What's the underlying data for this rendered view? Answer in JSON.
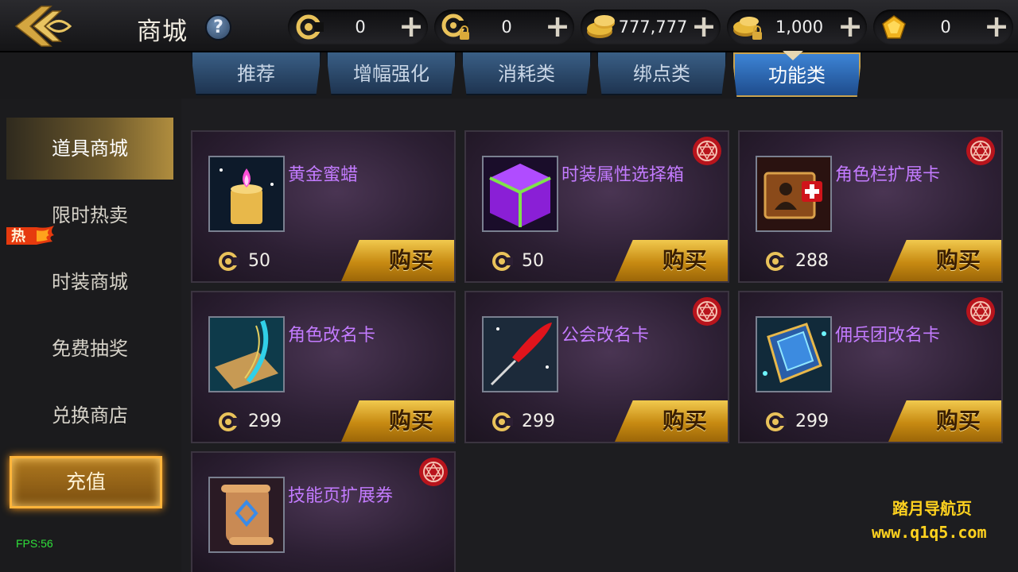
{
  "header": {
    "title": "商城",
    "help_glyph": "?",
    "currencies": [
      {
        "icon": "coin-c-icon",
        "value": "0"
      },
      {
        "icon": "coin-c-locked-icon",
        "value": "0"
      },
      {
        "icon": "gold-coins-icon",
        "value": "777,777"
      },
      {
        "icon": "gold-coins-locked-icon",
        "value": "1,000"
      },
      {
        "icon": "gem-icon",
        "value": "0"
      }
    ],
    "plus_glyph": "+"
  },
  "tabs": [
    {
      "label": "推荐",
      "active": false
    },
    {
      "label": "增幅强化",
      "active": false
    },
    {
      "label": "消耗类",
      "active": false
    },
    {
      "label": "绑点类",
      "active": false
    },
    {
      "label": "功能类",
      "active": true
    }
  ],
  "sidebar": {
    "items": [
      {
        "label": "道具商城",
        "active": true
      },
      {
        "label": "限时热卖",
        "active": false,
        "badge": "热"
      },
      {
        "label": "时装商城",
        "active": false
      },
      {
        "label": "免费抽奖",
        "active": false
      },
      {
        "label": "兑换商店",
        "active": false
      }
    ],
    "recharge_label": "充值",
    "fps": "FPS:56"
  },
  "products": [
    {
      "name": "黄金蜜蜡",
      "price": "50",
      "icon": "golden-candle-icon",
      "seal": false,
      "buy": "购买"
    },
    {
      "name": "时装属性选择箱",
      "price": "50",
      "icon": "purple-box-icon",
      "seal": true,
      "buy": "购买"
    },
    {
      "name": "角色栏扩展卡",
      "price": "288",
      "icon": "character-slot-card-icon",
      "seal": true,
      "buy": "购买"
    },
    {
      "name": "角色改名卡",
      "price": "299",
      "icon": "rename-scroll-icon",
      "seal": false,
      "buy": "购买"
    },
    {
      "name": "公会改名卡",
      "price": "299",
      "icon": "red-quill-icon",
      "seal": true,
      "buy": "购买"
    },
    {
      "name": "佣兵团改名卡",
      "price": "299",
      "icon": "guild-rename-book-icon",
      "seal": true,
      "buy": "购买"
    },
    {
      "name": "技能页扩展券",
      "price": "",
      "icon": "skill-scroll-icon",
      "seal": true,
      "buy": ""
    }
  ],
  "watermark": {
    "line1": "踏月导航页",
    "line2": "www.q1q5.com"
  },
  "colors": {
    "item_name": "#c37bff",
    "buy_button": "#e0a82a",
    "tab_active": "#2f6cb8",
    "fps": "#2fe03a",
    "watermark": "#ffd21f"
  }
}
